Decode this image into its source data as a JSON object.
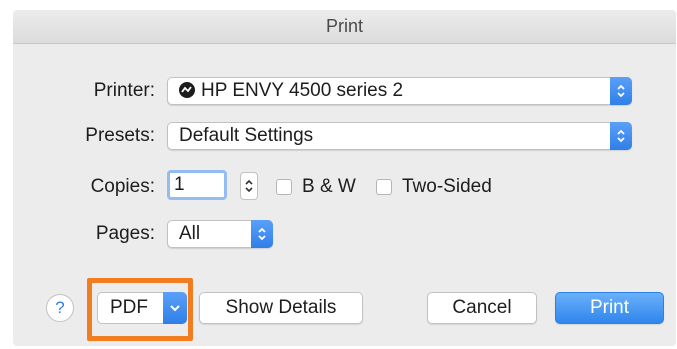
{
  "window": {
    "title": "Print"
  },
  "printer": {
    "label": "Printer:",
    "value": "HP ENVY 4500 series 2"
  },
  "presets": {
    "label": "Presets:",
    "value": "Default Settings"
  },
  "copies": {
    "label": "Copies:",
    "value": "1"
  },
  "options": {
    "bw_label": "B & W",
    "two_sided_label": "Two-Sided"
  },
  "pages": {
    "label": "Pages:",
    "value": "All"
  },
  "footer": {
    "help_label": "?",
    "pdf_label": "PDF",
    "show_details_label": "Show Details",
    "cancel_label": "Cancel",
    "print_label": "Print"
  },
  "colors": {
    "accent": "#2f7fe8",
    "highlight": "#f07d1f"
  }
}
